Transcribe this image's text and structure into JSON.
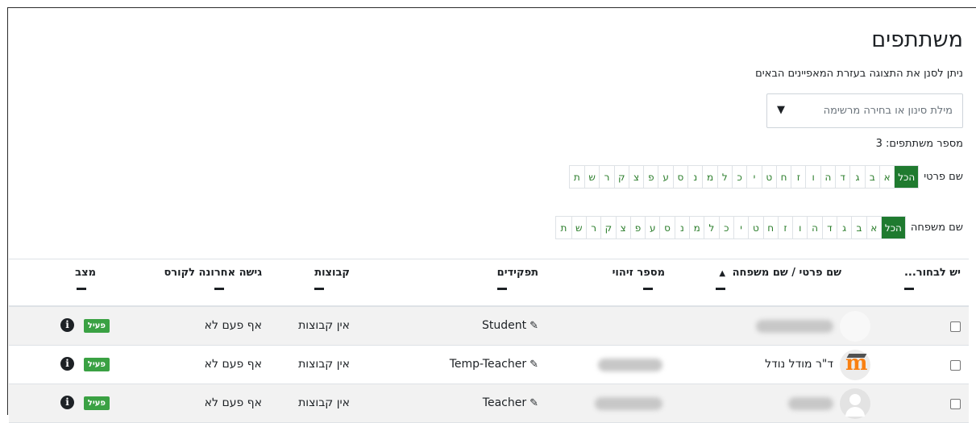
{
  "page": {
    "title": "משתתפים",
    "subtitle": "ניתן לסנן את התצוגה בעזרת המאפיינים הבאים",
    "filter_placeholder": "מילת סינון או בחירה מרשימה",
    "filter_arrow": "▼",
    "participant_count": "מספר משתתפים: 3"
  },
  "initials": {
    "first_name_label": "שם פרטי",
    "last_name_label": "שם משפחה",
    "all_label": "הכל",
    "letters": [
      "א",
      "ב",
      "ג",
      "ד",
      "ה",
      "ו",
      "ז",
      "ח",
      "ט",
      "י",
      "כ",
      "ל",
      "מ",
      "נ",
      "ס",
      "ע",
      "פ",
      "צ",
      "ק",
      "ר",
      "ש",
      "ת"
    ]
  },
  "table": {
    "headers": {
      "select": "יש לבחור...",
      "name": "שם פרטי / שם משפחה",
      "sort_caret": "▲",
      "id_number": "מספר זיהוי",
      "roles": "תפקידים",
      "groups": "קבוצות",
      "last_access": "גישה אחרונה לקורס",
      "status": "מצב"
    },
    "rows": [
      {
        "name": "",
        "role": "Student",
        "groups": "אין קבוצות",
        "last_access": "אף פעם לא",
        "status": "פעיל",
        "avatar": "blank"
      },
      {
        "name": "ד\"ר מודל נודל",
        "role": "Temp-Teacher",
        "groups": "אין קבוצות",
        "last_access": "אף פעם לא",
        "status": "פעיל",
        "avatar": "moodle"
      },
      {
        "name": "",
        "role": "Teacher",
        "groups": "אין קבוצות",
        "last_access": "אף פעם לא",
        "status": "פעיל",
        "avatar": "default"
      }
    ]
  },
  "icons": {
    "pencil": "✎",
    "info": "i"
  },
  "colors": {
    "accent_green": "#1f7a2f",
    "badge_green": "#3aa143",
    "letter_link": "#2a7d2a"
  }
}
